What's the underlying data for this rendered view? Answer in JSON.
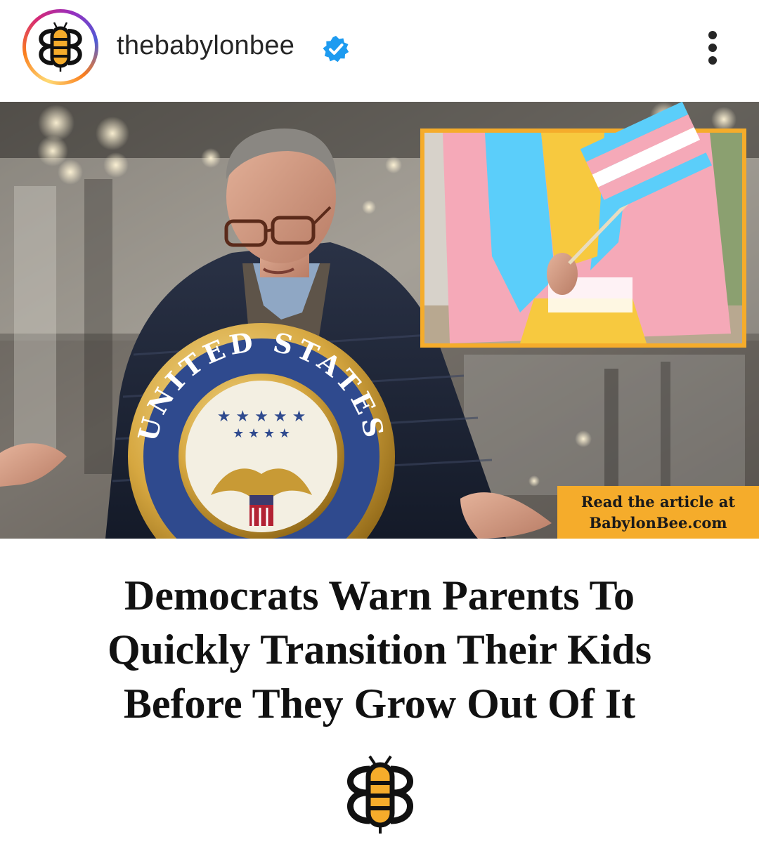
{
  "header": {
    "username": "thebabylonbee",
    "verified_icon": "verified-badge-icon",
    "more_icon": "more-options-icon",
    "avatar_icon": "babylon-bee-logo-icon"
  },
  "post": {
    "image_description_badge": {
      "line1": "Read the article at",
      "line2": "BabylonBee.com"
    },
    "headline": {
      "line1": "Democrats Warn Parents To",
      "line2": "Quickly Transition Their Kids",
      "line3": "Before They Grow Out Of It"
    },
    "seal_text": "UNITED STATES",
    "footer_logo_icon": "babylon-bee-logo-icon"
  },
  "colors": {
    "accent_orange": "#f5ac2b",
    "verified_blue": "#1d9bf0",
    "text_dark": "#262626",
    "trans_blue": "#5bcefa",
    "trans_pink": "#f5a9b8"
  }
}
